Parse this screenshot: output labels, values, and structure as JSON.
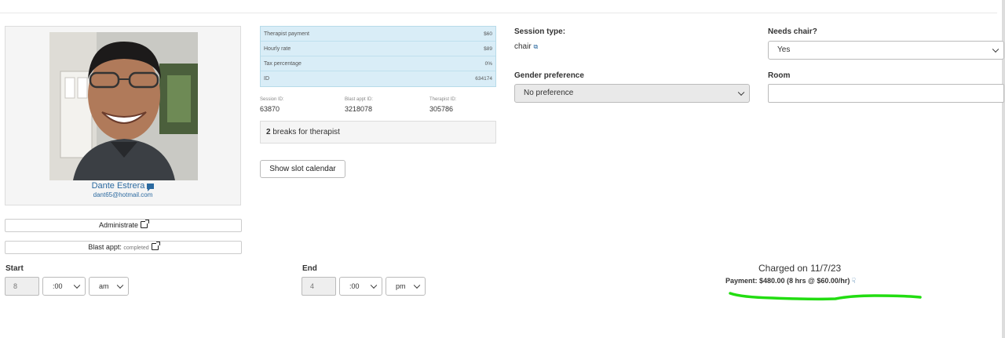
{
  "profile": {
    "name": "Dante Estrera",
    "email": "dant65@hotmail.com"
  },
  "actions": {
    "administrate_label": "Administrate",
    "blast_label": "Blast appt:",
    "blast_status": "completed"
  },
  "info_table": {
    "rows": [
      {
        "label": "Therapist payment",
        "value": "$60"
      },
      {
        "label": "Hourly rate",
        "value": "$89"
      },
      {
        "label": "Tax percentage",
        "value": "0%"
      },
      {
        "label": "ID",
        "value": "634174"
      }
    ]
  },
  "ids": {
    "session_label": "Session ID:",
    "session_value": "63870",
    "blast_label": "Blast appt ID:",
    "blast_value": "3218078",
    "therapist_label": "Therapist ID:",
    "therapist_value": "305786"
  },
  "breaks": {
    "count": "2",
    "text": "breaks for therapist"
  },
  "slot_calendar_label": "Show  slot calendar",
  "session": {
    "type_label": "Session type:",
    "type_value": "chair",
    "gender_label": "Gender preference",
    "gender_value": "No preference",
    "chair_label": "Needs chair?",
    "chair_value": "Yes",
    "room_label": "Room",
    "room_value": ""
  },
  "time": {
    "start_label": "Start",
    "start_hour": "8",
    "start_min": ":00",
    "start_ampm": "am",
    "end_label": "End",
    "end_hour": "4",
    "end_min": ":00",
    "end_ampm": "pm"
  },
  "charge": {
    "charged_prefix": "Charged on",
    "charged_date": "11/7/23",
    "payment_text": "Payment: $480.00 (8 hrs @ $60.00/hr)"
  },
  "colors": {
    "info_bg": "#d9edf7",
    "link": "#2c6aa0",
    "highlight": "#22dd11"
  }
}
